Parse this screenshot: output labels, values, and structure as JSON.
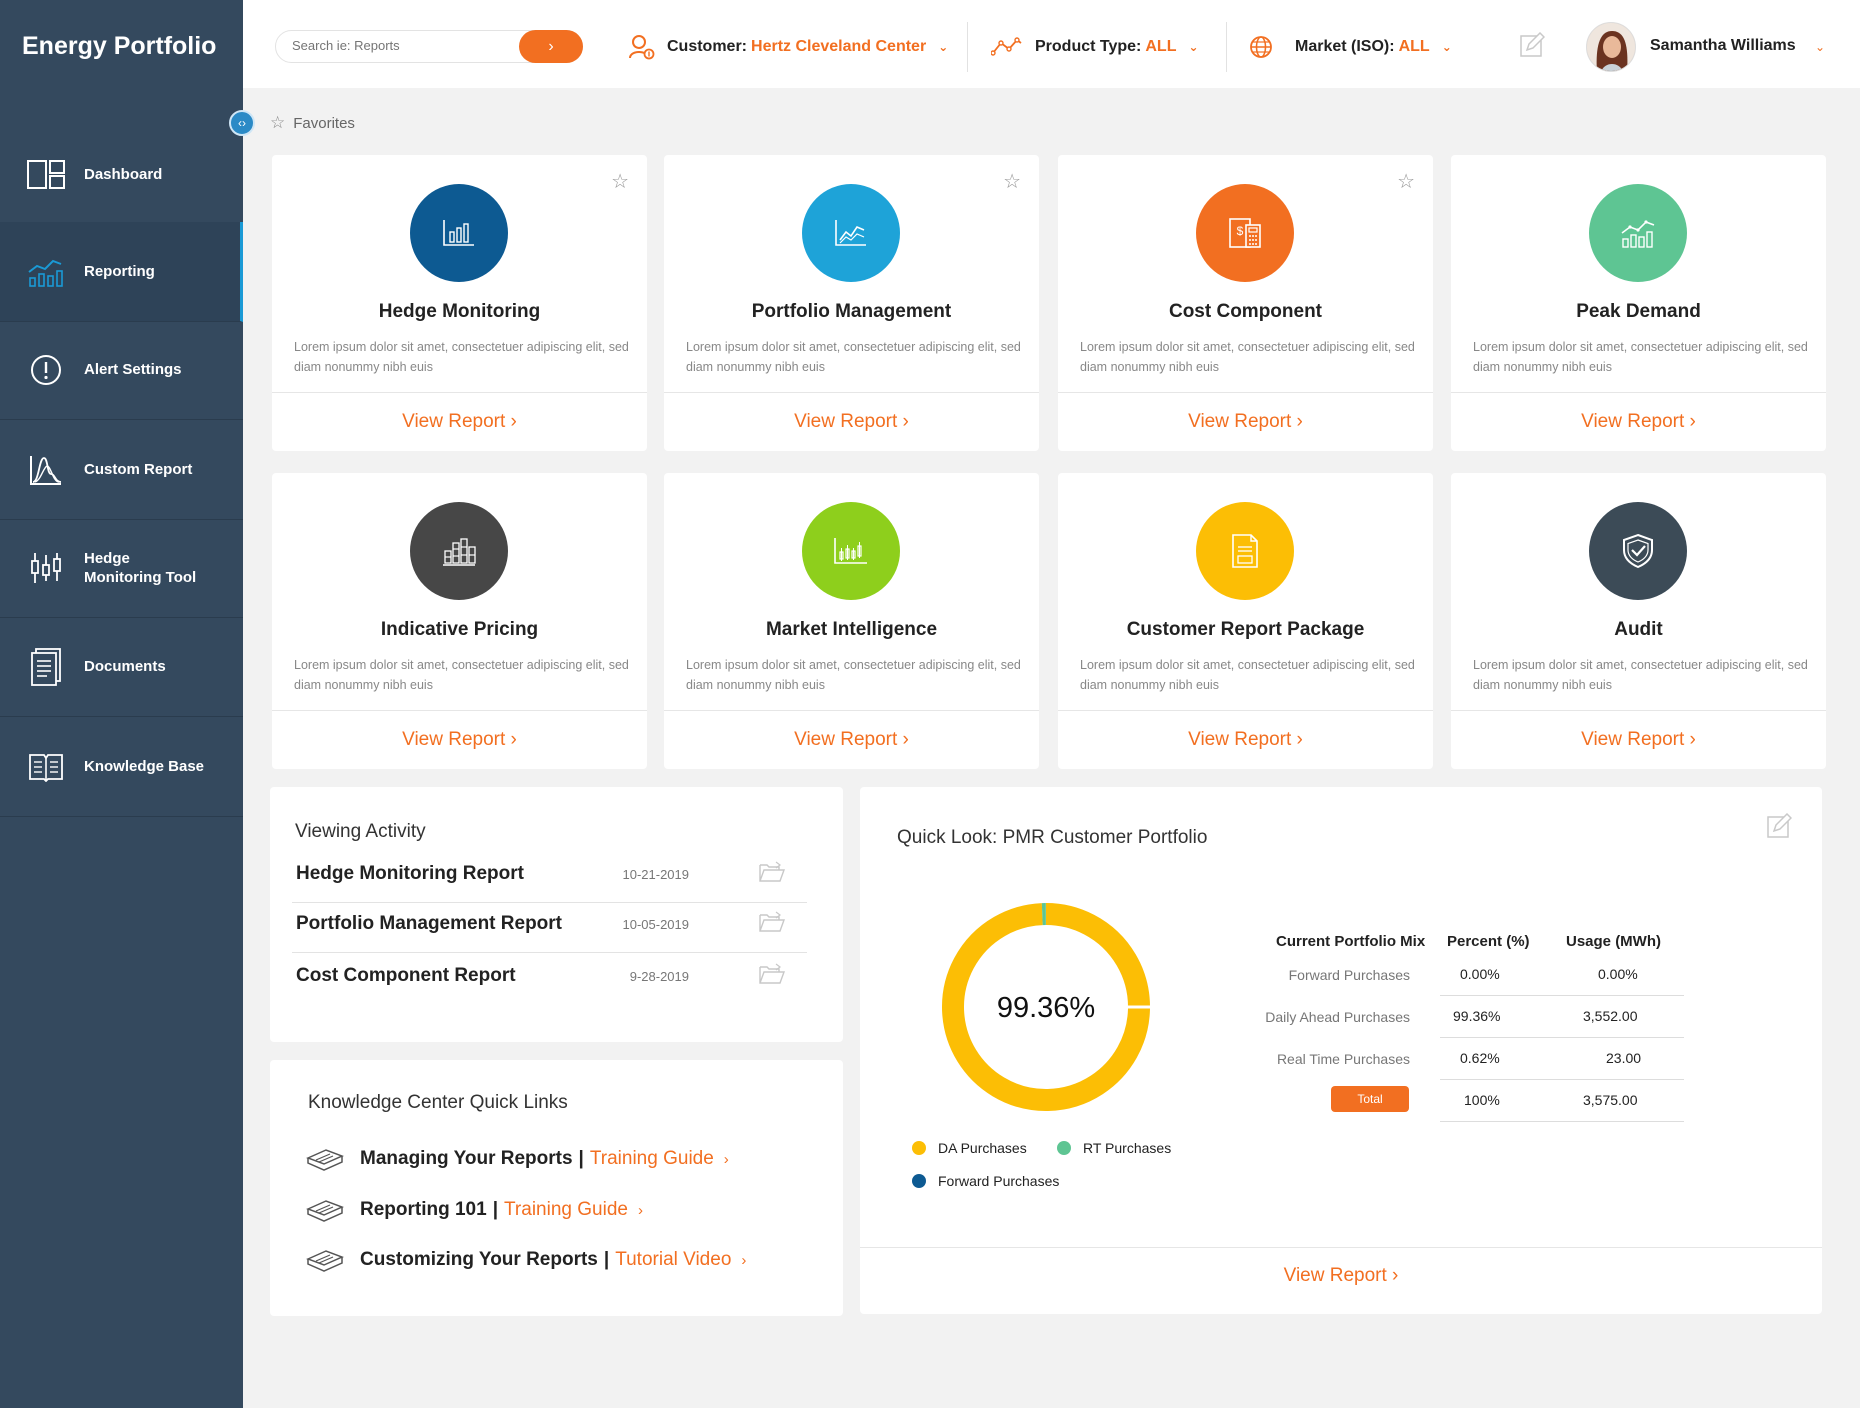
{
  "app": {
    "title": "Energy Portfolio"
  },
  "sidebar": {
    "items": [
      {
        "label": "Dashboard",
        "icon": "dashboard-icon"
      },
      {
        "label": "Reporting",
        "icon": "reporting-icon",
        "active": true
      },
      {
        "label": "Alert Settings",
        "icon": "alert-icon"
      },
      {
        "label": "Custom Report",
        "icon": "custom-report-icon"
      },
      {
        "label": "Hedge\nMonitoring Tool",
        "icon": "hedge-tool-icon"
      },
      {
        "label": "Documents",
        "icon": "documents-icon"
      },
      {
        "label": "Knowledge Base",
        "icon": "knowledge-base-icon"
      }
    ]
  },
  "header": {
    "search_placeholder": "Search ie: Reports",
    "filters": [
      {
        "label": "Customer:",
        "value": "Hertz Cleveland Center",
        "icon": "customer-icon"
      },
      {
        "label": "Product Type:",
        "value": "ALL",
        "icon": "product-type-icon"
      },
      {
        "label": "Market (ISO):",
        "value": "ALL",
        "icon": "globe-icon"
      }
    ],
    "user_name": "Samantha Williams"
  },
  "favorites_label": "Favorites",
  "cards": [
    {
      "title": "Hedge Monitoring",
      "color": "#0d5a92",
      "icon": "bar-chart-icon",
      "starred_outline": true,
      "desc": "Lorem ipsum dolor sit amet, consectetuer adipiscing elit, sed diam nonummy nibh euis",
      "link": "View Report"
    },
    {
      "title": "Portfolio Management",
      "color": "#1ea3d8",
      "icon": "line-chart-icon",
      "starred_outline": true,
      "desc": "Lorem ipsum dolor sit amet, consectetuer adipiscing elit, sed diam nonummy nibh euis",
      "link": "View Report"
    },
    {
      "title": "Cost Component",
      "color": "#f26f21",
      "icon": "calculator-icon",
      "starred_outline": true,
      "desc": "Lorem ipsum dolor sit amet, consectetuer adipiscing elit, sed diam nonummy nibh euis",
      "link": "View Report"
    },
    {
      "title": "Peak Demand",
      "color": "#5ec593",
      "icon": "trend-bars-icon",
      "starred_outline": false,
      "desc": "Lorem ipsum dolor sit amet, consectetuer adipiscing elit, sed diam nonummy nibh euis",
      "link": "View Report"
    },
    {
      "title": "Indicative Pricing",
      "color": "#474747",
      "icon": "stacked-bars-icon",
      "starred_outline": false,
      "desc": "Lorem ipsum dolor sit amet, consectetuer adipiscing elit, sed diam nonummy nibh euis",
      "link": "View Report"
    },
    {
      "title": "Market Intelligence",
      "color": "#8ecf1c",
      "icon": "market-chart-icon",
      "starred_outline": false,
      "desc": "Lorem ipsum dolor sit amet, consectetuer adipiscing elit, sed diam nonummy nibh euis",
      "link": "View Report"
    },
    {
      "title": "Customer Report Package",
      "color": "#fcbe05",
      "icon": "document-report-icon",
      "starred_outline": false,
      "desc": "Lorem ipsum dolor sit amet, consectetuer adipiscing elit, sed diam nonummy nibh euis",
      "link": "View Report"
    },
    {
      "title": "Audit",
      "color": "#3c4b57",
      "icon": "shield-check-icon",
      "starred_outline": false,
      "desc": "Lorem ipsum dolor sit amet, consectetuer adipiscing elit, sed diam nonummy nibh euis",
      "link": "View Report"
    }
  ],
  "viewing_activity": {
    "title": "Viewing Activity",
    "rows": [
      {
        "name": "Hedge Monitoring Report",
        "date": "10-21-2019"
      },
      {
        "name": "Portfolio Management Report",
        "date": "10-05-2019"
      },
      {
        "name": "Cost Component Report",
        "date": "9-28-2019"
      }
    ]
  },
  "knowledge_center": {
    "title": "Knowledge Center Quick Links",
    "links": [
      {
        "name": "Managing Your Reports",
        "type": "Training Guide"
      },
      {
        "name": "Reporting 101",
        "type": "Training Guide"
      },
      {
        "name": "Customizing Your Reports",
        "type": "Tutorial Video"
      }
    ]
  },
  "quick_look": {
    "title": "Quick Look: PMR Customer Portfolio",
    "donut_center": "99.36%",
    "donut_segments": [
      {
        "name": "DA Purchases",
        "percent": 99.36,
        "color": "#fcbe05"
      },
      {
        "name": "RT Purchases",
        "percent": 0.62,
        "color": "#5ec593"
      },
      {
        "name": "Forward Purchases",
        "percent": 0.0,
        "color": "#0d5a92"
      }
    ],
    "legend": [
      "DA Purchases",
      "RT Purchases",
      "Forward Purchases"
    ],
    "table": {
      "headers": [
        "Current Portfolio Mix",
        "Percent (%)",
        "Usage (MWh)"
      ],
      "rows": [
        {
          "label": "Forward Purchases",
          "percent": "0.00%",
          "usage": "0.00%"
        },
        {
          "label": "Daily Ahead Purchases",
          "percent": "99.36%",
          "usage": "3,552.00"
        },
        {
          "label": "Real Time Purchases",
          "percent": "0.62%",
          "usage": "23.00"
        }
      ],
      "total": {
        "label": "Total",
        "percent": "100%",
        "usage": "3,575.00"
      }
    },
    "link": "View Report"
  },
  "colors": {
    "accent": "#f26f21",
    "sidebar": "#34495e",
    "active_border": "#1a9ad6"
  }
}
